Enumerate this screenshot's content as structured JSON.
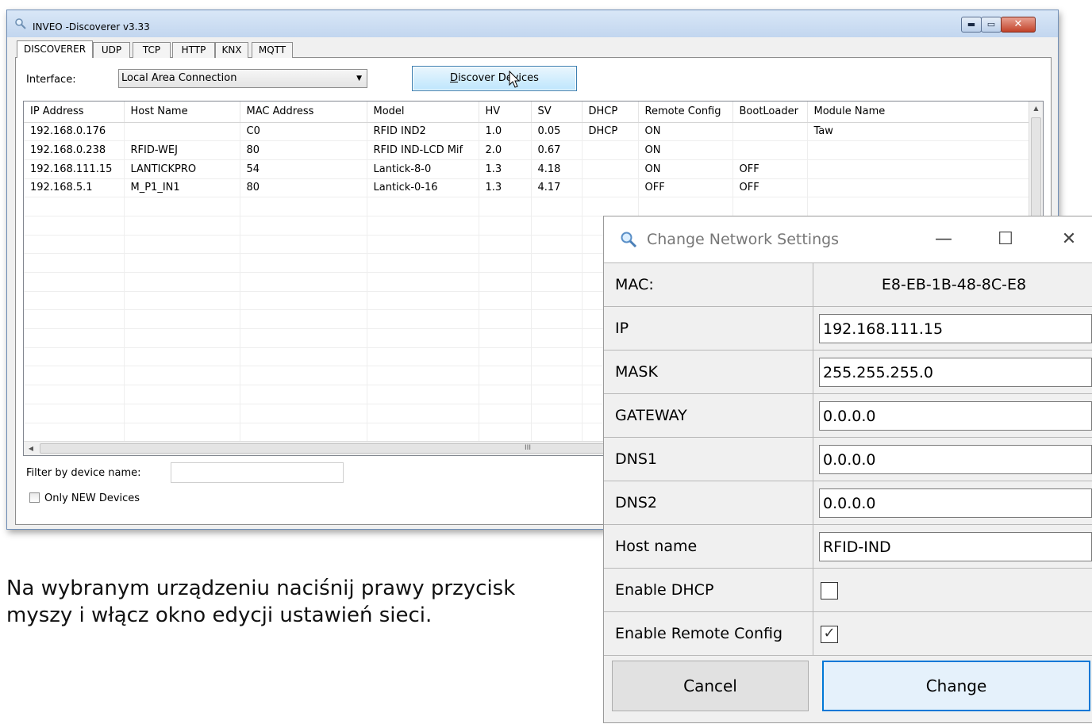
{
  "main_window": {
    "title": "INVEO -Discoverer v3.33",
    "tabs": [
      "DISCOVERER",
      "UDP",
      "TCP",
      "HTTP",
      "KNX",
      "MQTT"
    ],
    "interface_label": "Interface:",
    "interface_value": "Local Area Connection",
    "discover_pre": "D",
    "discover_post": "iscover Devices",
    "columns": [
      "IP Address",
      "Host Name",
      "MAC Address",
      "Model",
      "HV",
      "SV",
      "DHCP",
      "Remote Config",
      "BootLoader",
      "Module Name"
    ],
    "rows": [
      [
        "192.168.0.176",
        "",
        "C0",
        "RFID IND2",
        "1.0",
        "0.05",
        "DHCP",
        "ON",
        "",
        "Taw"
      ],
      [
        "192.168.0.238",
        "RFID-WEJ",
        "80",
        "RFID IND-LCD Mif",
        "2.0",
        "0.67",
        "",
        "ON",
        "",
        ""
      ],
      [
        "192.168.111.15",
        "LANTICKPRO",
        "54",
        "Lantick-8-0",
        "1.3",
        "4.18",
        "",
        "ON",
        "OFF",
        ""
      ],
      [
        "192.168.5.1",
        "M_P1_IN1",
        "80",
        "Lantick-0-16",
        "1.3",
        "4.17",
        "",
        "OFF",
        "OFF",
        ""
      ]
    ],
    "hscroll_grip": "III",
    "filter_label": "Filter by device name:",
    "filter_value": "",
    "only_new_label": "Only NEW Devices",
    "only_new_checked": false
  },
  "caption": {
    "line1": "Na wybranym urządzeniu naciśnij prawy przycisk",
    "line2": "myszy i włącz okno edycji ustawień sieci."
  },
  "dialog": {
    "title": "Change Network Settings",
    "min_glyph": "—",
    "max_glyph": "☐",
    "close_glyph": "✕",
    "mac_label": "MAC:",
    "mac_value": "E8-EB-1B-48-8C-E8",
    "ip_label": "IP",
    "ip_value": "192.168.111.15",
    "mask_label": "MASK",
    "mask_value": "255.255.255.0",
    "gateway_label": "GATEWAY",
    "gateway_value": "0.0.0.0",
    "dns1_label": "DNS1",
    "dns1_value": "0.0.0.0",
    "dns2_label": "DNS2",
    "dns2_value": "0.0.0.0",
    "hostname_label": "Host name",
    "hostname_value": "RFID-IND",
    "dhcp_label": "Enable DHCP",
    "dhcp_checked": false,
    "remote_label": "Enable Remote Config",
    "remote_checked": true,
    "check_glyph": "✓",
    "cancel_label": "Cancel",
    "change_label": "Change"
  },
  "colors": {
    "accent": "#0078d7",
    "title_gradient_top": "#d9e7f7",
    "close_red": "#c2432a"
  },
  "icons": [
    "search-icon",
    "mouse-cursor-icon",
    "minimize-icon",
    "maximize-icon",
    "close-icon",
    "checkbox-icon"
  ]
}
